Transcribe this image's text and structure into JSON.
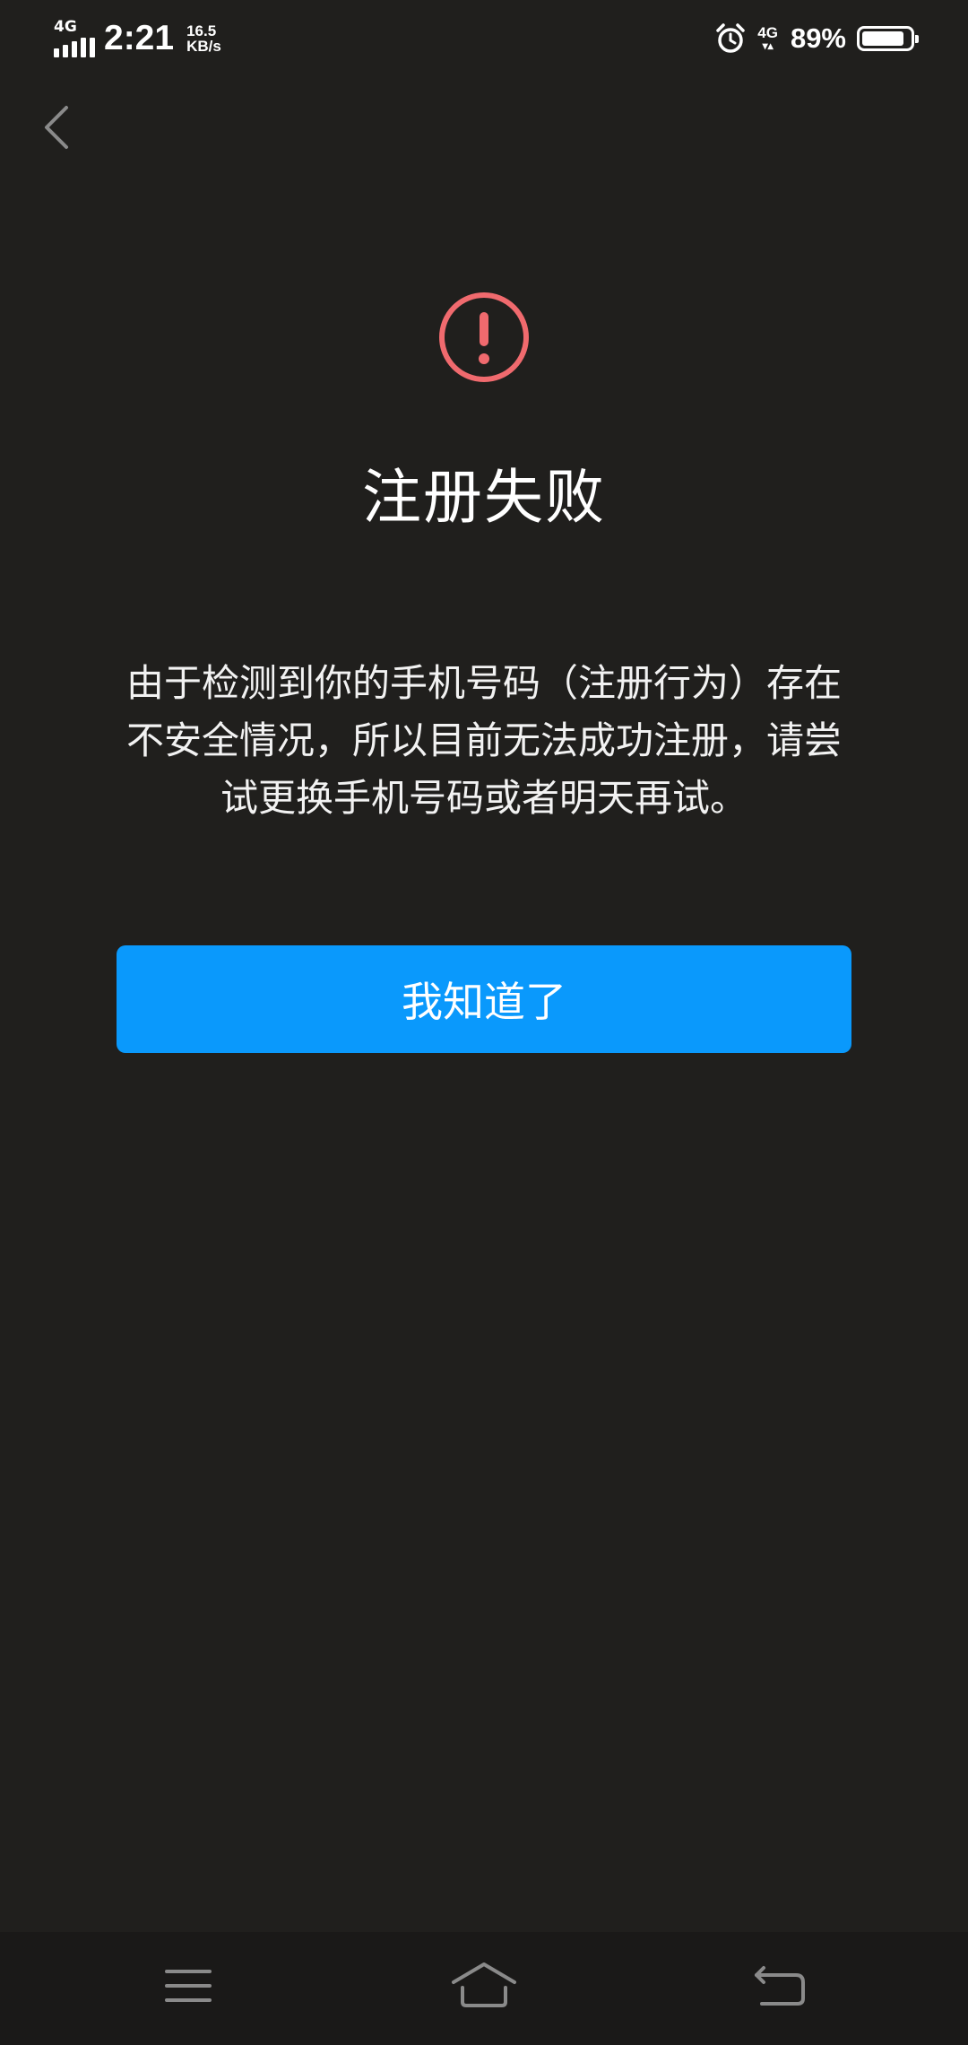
{
  "status_bar": {
    "network_left": "4G",
    "time": "2:21",
    "speed_value": "16.5",
    "speed_unit": "KB/s",
    "network_right": "4G",
    "battery_percent": "89%",
    "battery_level": 0.89,
    "icons": [
      "signal-icon",
      "alarm-icon",
      "data-arrows-icon",
      "battery-icon"
    ]
  },
  "header": {
    "back_icon": "chevron-left-icon"
  },
  "main": {
    "status_icon": "error-exclamation-icon",
    "title": "注册失败",
    "message": "由于检测到你的手机号码（注册行为）存在不安全情况，所以目前无法成功注册，请尝试更换手机号码或者明天再试。",
    "confirm_label": "我知道了"
  },
  "nav_bar": {
    "icons": [
      "menu-icon",
      "home-icon",
      "back-icon"
    ]
  },
  "colors": {
    "background": "#201f1d",
    "nav_background": "#1a1918",
    "accent": "#0a99fc",
    "error": "#f06a6e",
    "text": "#ffffff"
  }
}
